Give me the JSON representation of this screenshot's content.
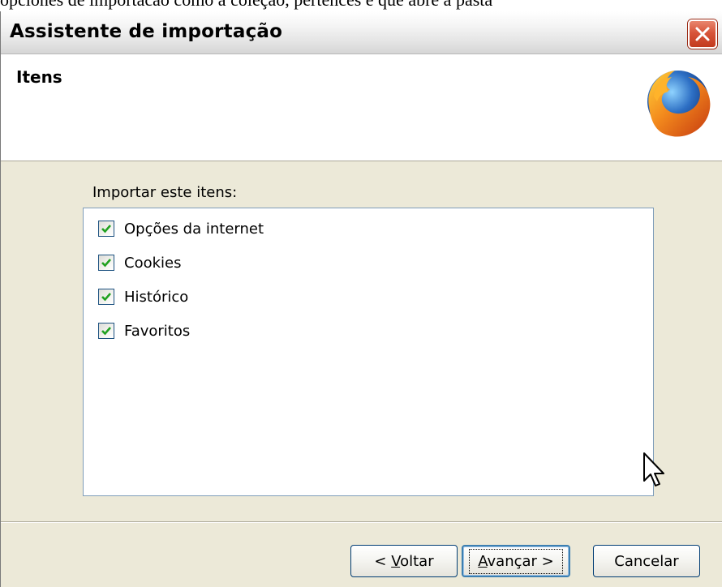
{
  "page": {
    "top_text": "opciones de importacao como a coleção, pertences e que abre a pasta"
  },
  "window": {
    "title": "Assistente de importação",
    "close_icon": "close-icon"
  },
  "header": {
    "title": "Itens",
    "logo": "firefox-logo-icon"
  },
  "main": {
    "import_label": "Importar este itens:",
    "items": [
      {
        "label": "Opções da internet",
        "checked": true
      },
      {
        "label": "Cookies",
        "checked": true
      },
      {
        "label": "Histórico",
        "checked": true
      },
      {
        "label": "Favoritos",
        "checked": true
      }
    ]
  },
  "buttons": {
    "back_prefix": "< ",
    "back_mnemonic": "V",
    "back_rest": "oltar",
    "next_mnemonic": "A",
    "next_rest": "vançar >",
    "cancel": "Cancelar"
  },
  "colors": {
    "dialog_bg": "#ece9d8",
    "list_border": "#7f9db9",
    "check_color": "#21a121",
    "close_red": "#d8553a"
  }
}
